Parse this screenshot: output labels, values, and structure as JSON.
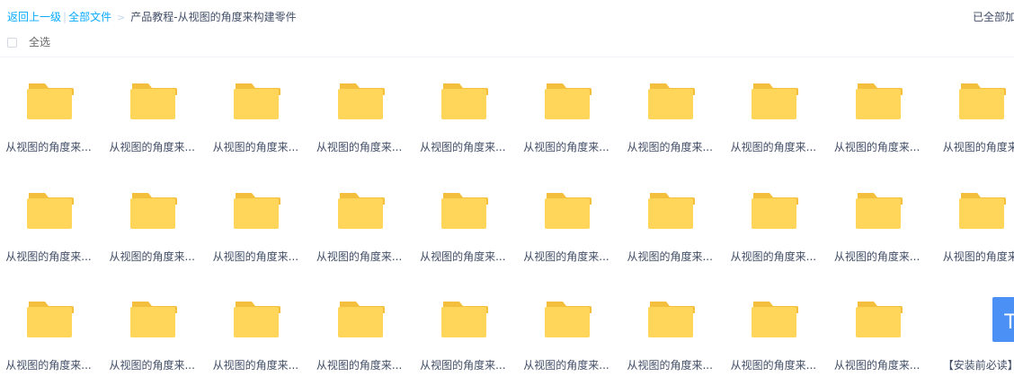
{
  "breadcrumb": {
    "back": "返回上一级",
    "separator": "|",
    "all_files": "全部文件",
    "arrow": ">",
    "current": "产品教程-从视图的角度来构建零件"
  },
  "status": {
    "loaded_text": "已全部加载"
  },
  "toolbar": {
    "select_all": "全选"
  },
  "colors": {
    "folder_body": "#ffd659",
    "folder_tab": "#f4bf3c",
    "doc_blue": "#4a90f5",
    "doc_fold": "#a9c8fb",
    "link": "#09aaff"
  },
  "items": [
    {
      "name": "从视图的角度来...",
      "type": "folder"
    },
    {
      "name": "从视图的角度来...",
      "type": "folder"
    },
    {
      "name": "从视图的角度来...",
      "type": "folder"
    },
    {
      "name": "从视图的角度来...",
      "type": "folder"
    },
    {
      "name": "从视图的角度来...",
      "type": "folder"
    },
    {
      "name": "从视图的角度来...",
      "type": "folder"
    },
    {
      "name": "从视图的角度来...",
      "type": "folder"
    },
    {
      "name": "从视图的角度来...",
      "type": "folder"
    },
    {
      "name": "从视图的角度来...",
      "type": "folder"
    },
    {
      "name": "从视图的角度来",
      "type": "folder"
    },
    {
      "name": "从视图的角度来...",
      "type": "folder"
    },
    {
      "name": "从视图的角度来...",
      "type": "folder"
    },
    {
      "name": "从视图的角度来...",
      "type": "folder"
    },
    {
      "name": "从视图的角度来...",
      "type": "folder"
    },
    {
      "name": "从视图的角度来...",
      "type": "folder"
    },
    {
      "name": "从视图的角度来...",
      "type": "folder"
    },
    {
      "name": "从视图的角度来...",
      "type": "folder"
    },
    {
      "name": "从视图的角度来...",
      "type": "folder"
    },
    {
      "name": "从视图的角度来...",
      "type": "folder"
    },
    {
      "name": "从视图的角度来",
      "type": "folder"
    },
    {
      "name": "从视图的角度来...",
      "type": "folder"
    },
    {
      "name": "从视图的角度来...",
      "type": "folder"
    },
    {
      "name": "从视图的角度来...",
      "type": "folder"
    },
    {
      "name": "从视图的角度来...",
      "type": "folder"
    },
    {
      "name": "从视图的角度来...",
      "type": "folder"
    },
    {
      "name": "从视图的角度来...",
      "type": "folder"
    },
    {
      "name": "从视图的角度来...",
      "type": "folder"
    },
    {
      "name": "从视图的角度来...",
      "type": "folder"
    },
    {
      "name": "从视图的角度来...",
      "type": "folder"
    },
    {
      "name": "【安装前必读】",
      "type": "txt",
      "icon_letter": "T"
    }
  ]
}
